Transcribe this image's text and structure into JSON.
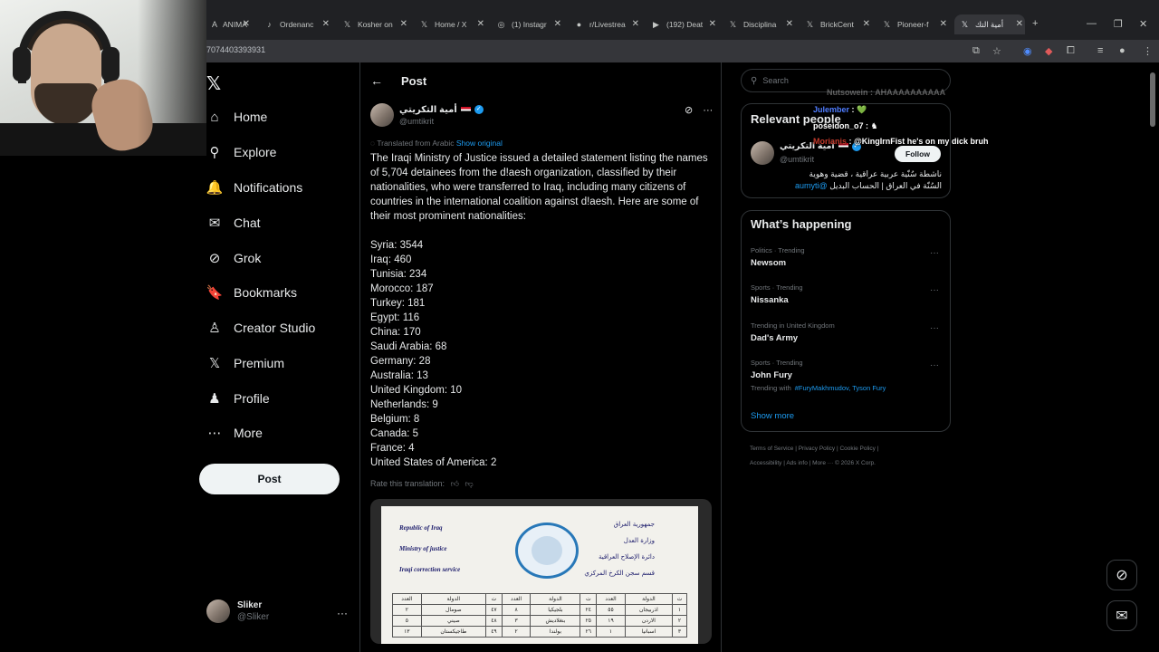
{
  "browser": {
    "tabs": [
      {
        "label": "ANIMA",
        "fav": "A"
      },
      {
        "label": "Ordenanc",
        "fav": "♪"
      },
      {
        "label": "Kosher on",
        "fav": "𝕏"
      },
      {
        "label": "Home / X",
        "fav": "𝕏"
      },
      {
        "label": "(1) Instagr",
        "fav": "◎"
      },
      {
        "label": "r/Livestrea",
        "fav": "●"
      },
      {
        "label": "(192) Deat",
        "fav": "▶"
      },
      {
        "label": "Disciplina",
        "fav": "𝕏"
      },
      {
        "label": "BrickCent",
        "fav": "𝕏"
      },
      {
        "label": "Pioneer-f",
        "fav": "𝕏"
      },
      {
        "label": "أمية التك",
        "fav": "𝕏"
      }
    ],
    "url": "7074403393931",
    "new_tab": "+",
    "win_controls": [
      "—",
      "❐",
      "✕"
    ]
  },
  "nav": {
    "logo": "𝕏",
    "items": [
      {
        "label": "Home",
        "icon": "⌂"
      },
      {
        "label": "Explore",
        "icon": "⚲"
      },
      {
        "label": "Notifications",
        "icon": "🔔"
      },
      {
        "label": "Chat",
        "icon": "✉"
      },
      {
        "label": "Grok",
        "icon": "⊘"
      },
      {
        "label": "Bookmarks",
        "icon": "🔖"
      },
      {
        "label": "Creator Studio",
        "icon": "♙"
      },
      {
        "label": "Premium",
        "icon": "𝕏"
      },
      {
        "label": "Profile",
        "icon": "♟"
      },
      {
        "label": "More",
        "icon": "⋯"
      }
    ],
    "post_label": "Post",
    "me": {
      "name": "Sliker",
      "handle": "@Sliker",
      "more": "···"
    }
  },
  "post": {
    "header": "Post",
    "back_icon": "←",
    "author_name": "أمية التكريتي",
    "author_handle": "@umtikrit",
    "translated_label": "Translated from Arabic",
    "show_original": "Show original",
    "text": "The Iraqi Ministry of Justice issued a detailed statement listing the names of 5,704 detainees from the d!aesh organization, classified by their nationalities, who were transferred to Iraq, including many citizens of countries in the international coalition against d!aesh. Here are some of their most prominent nationalities:",
    "nationalities": [
      "Syria: 3544",
      "Iraq: 460",
      "Tunisia: 234",
      "Morocco: 187",
      "Turkey: 181",
      "Egypt: 116",
      "China: 170",
      "Saudi Arabia: 68",
      "Germany: 28",
      "Australia: 13",
      "United Kingdom: 10",
      "Netherlands: 9",
      "Belgium: 8",
      "Canada: 5",
      "France: 4",
      "United States of America: 2"
    ],
    "rate_label": "Rate this translation:",
    "document": {
      "en_lines": [
        "Republic of Iraq",
        "Ministry of justice",
        "Iraqi correction service"
      ],
      "ar_lines": [
        "جمهورية العراق",
        "وزارة العدل",
        "دائرة الإصلاح العراقية",
        "قسم سجن الكرخ المركزي"
      ],
      "table": [
        [
          "العدد",
          "الدولة",
          "ت",
          "العدد",
          "الدولة",
          "ت",
          "العدد",
          "الدولة",
          "ت"
        ],
        [
          "٢",
          "صومال",
          "٤٧",
          "٨",
          "بلجيكيا",
          "٢٤",
          "٥٥",
          "اذربيجان",
          "١"
        ],
        [
          "٥",
          "صيني",
          "٤٨",
          "٣",
          "بنغلاديش",
          "٢٥",
          "١٩",
          "الاردن",
          "٢"
        ],
        [
          "١٣",
          "طاجيكستان",
          "٤٩",
          "٢",
          "بولندا",
          "٢٦",
          "١",
          "اسبانيا",
          "٣"
        ]
      ]
    }
  },
  "right": {
    "search_placeholder": "Search",
    "relevant_title": "Relevant people",
    "person": {
      "name": "أمية التكريتي",
      "handle": "@umtikrit",
      "follow": "Follow",
      "bio_line1": "ناشطة سُنّية عربية عراقية ، قضية وهوية",
      "bio_line2": "السُنّة في العراق | الحساب البديل",
      "bio_mention": "@aumyti"
    },
    "happening_title": "What’s happening",
    "trends": [
      {
        "meta": "Politics · Trending",
        "topic": "Newsom"
      },
      {
        "meta": "Sports · Trending",
        "topic": "Nissanka"
      },
      {
        "meta": "Trending in United Kingdom",
        "topic": "Dad's Army"
      },
      {
        "meta": "Sports · Trending",
        "topic": "John Fury",
        "extra_label": "Trending with",
        "extra_links": "#FuryMakhmudov, Tyson Fury"
      }
    ],
    "show_more": "Show more",
    "footer_line1": "Terms of Service  |  Privacy Policy  |  Cookie Policy  |",
    "footer_line2": "Accessibility  |  Ads info  |  More ···  © 2026 X Corp."
  },
  "chat": [
    {
      "user": "Nutsowein",
      "msg": "AHAAAAAAAAAA",
      "faded": true
    },
    {
      "user": "Julember",
      "msg": "💚",
      "faded": false
    },
    {
      "user": "poseidon_o7",
      "msg": "♞",
      "faded": false
    },
    {
      "user": "Morianis",
      "msg": "@KingIrnFist he's on my dick bruh",
      "faded": false
    }
  ],
  "colors": {
    "accent": "#1d9bf0",
    "bg": "#000000",
    "border": "#2f3336"
  }
}
